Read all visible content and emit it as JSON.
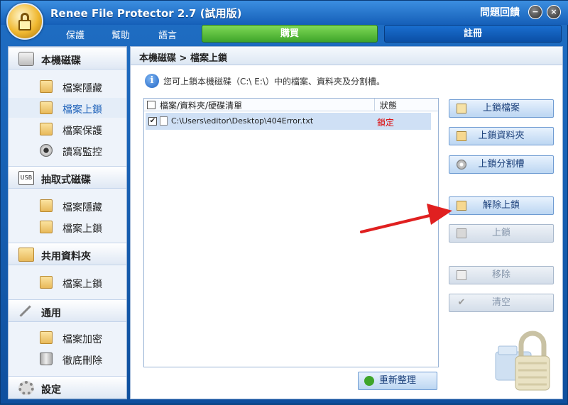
{
  "app": {
    "title": "Renee File Protector 2.7 (試用版)",
    "help_label": "問題回饋",
    "minimize_glyph": "−",
    "close_glyph": "×"
  },
  "menu": {
    "items": [
      "保護",
      "幫助",
      "語言"
    ]
  },
  "tabs": {
    "buy": "購買",
    "register": "註冊"
  },
  "sidebar": {
    "local_disk": {
      "header": "本機磁碟",
      "icon": "hard-disk-icon",
      "items": [
        "檔案隱藏",
        "檔案上鎖",
        "檔案保護",
        "讀寫監控"
      ]
    },
    "removable": {
      "header": "抽取式磁碟",
      "icon": "usb-drive-icon",
      "icon_text": "USB",
      "items": [
        "檔案隱藏",
        "檔案上鎖"
      ]
    },
    "shared": {
      "header": "共用資料夾",
      "icon": "shared-folder-icon",
      "items": [
        "檔案上鎖"
      ]
    },
    "general": {
      "header": "通用",
      "icon": "tools-icon",
      "items": [
        "檔案加密",
        "徹底刪除"
      ]
    },
    "settings": {
      "header": "設定",
      "icon": "gear-icon"
    }
  },
  "main": {
    "breadcrumb": "本機磁碟 > 檔案上鎖",
    "info_glyph": "i",
    "info": "您可上鎖本機磁碟（C:\\ E:\\）中的檔案、資料夾及分割槽。",
    "list": {
      "col_path": "檔案/資料夾/硬碟清單",
      "col_status": "狀態",
      "rows": [
        {
          "checked": true,
          "path": "C:\\Users\\editor\\Desktop\\404Error.txt",
          "status": "鎖定"
        }
      ]
    },
    "check_glyph": "✔",
    "reorganize": "重新整理"
  },
  "actions": {
    "lock_file": "上鎖檔案",
    "lock_folder": "上鎖資料夾",
    "lock_partition": "上鎖分割槽",
    "unlock": "解除上鎖",
    "lock": "上鎖",
    "remove": "移除",
    "clear": "清空"
  },
  "colors": {
    "accent_blue": "#1a5fb8",
    "buy_green": "#3fa52a",
    "status_red": "#dd0000",
    "arrow_red": "#e02020"
  }
}
